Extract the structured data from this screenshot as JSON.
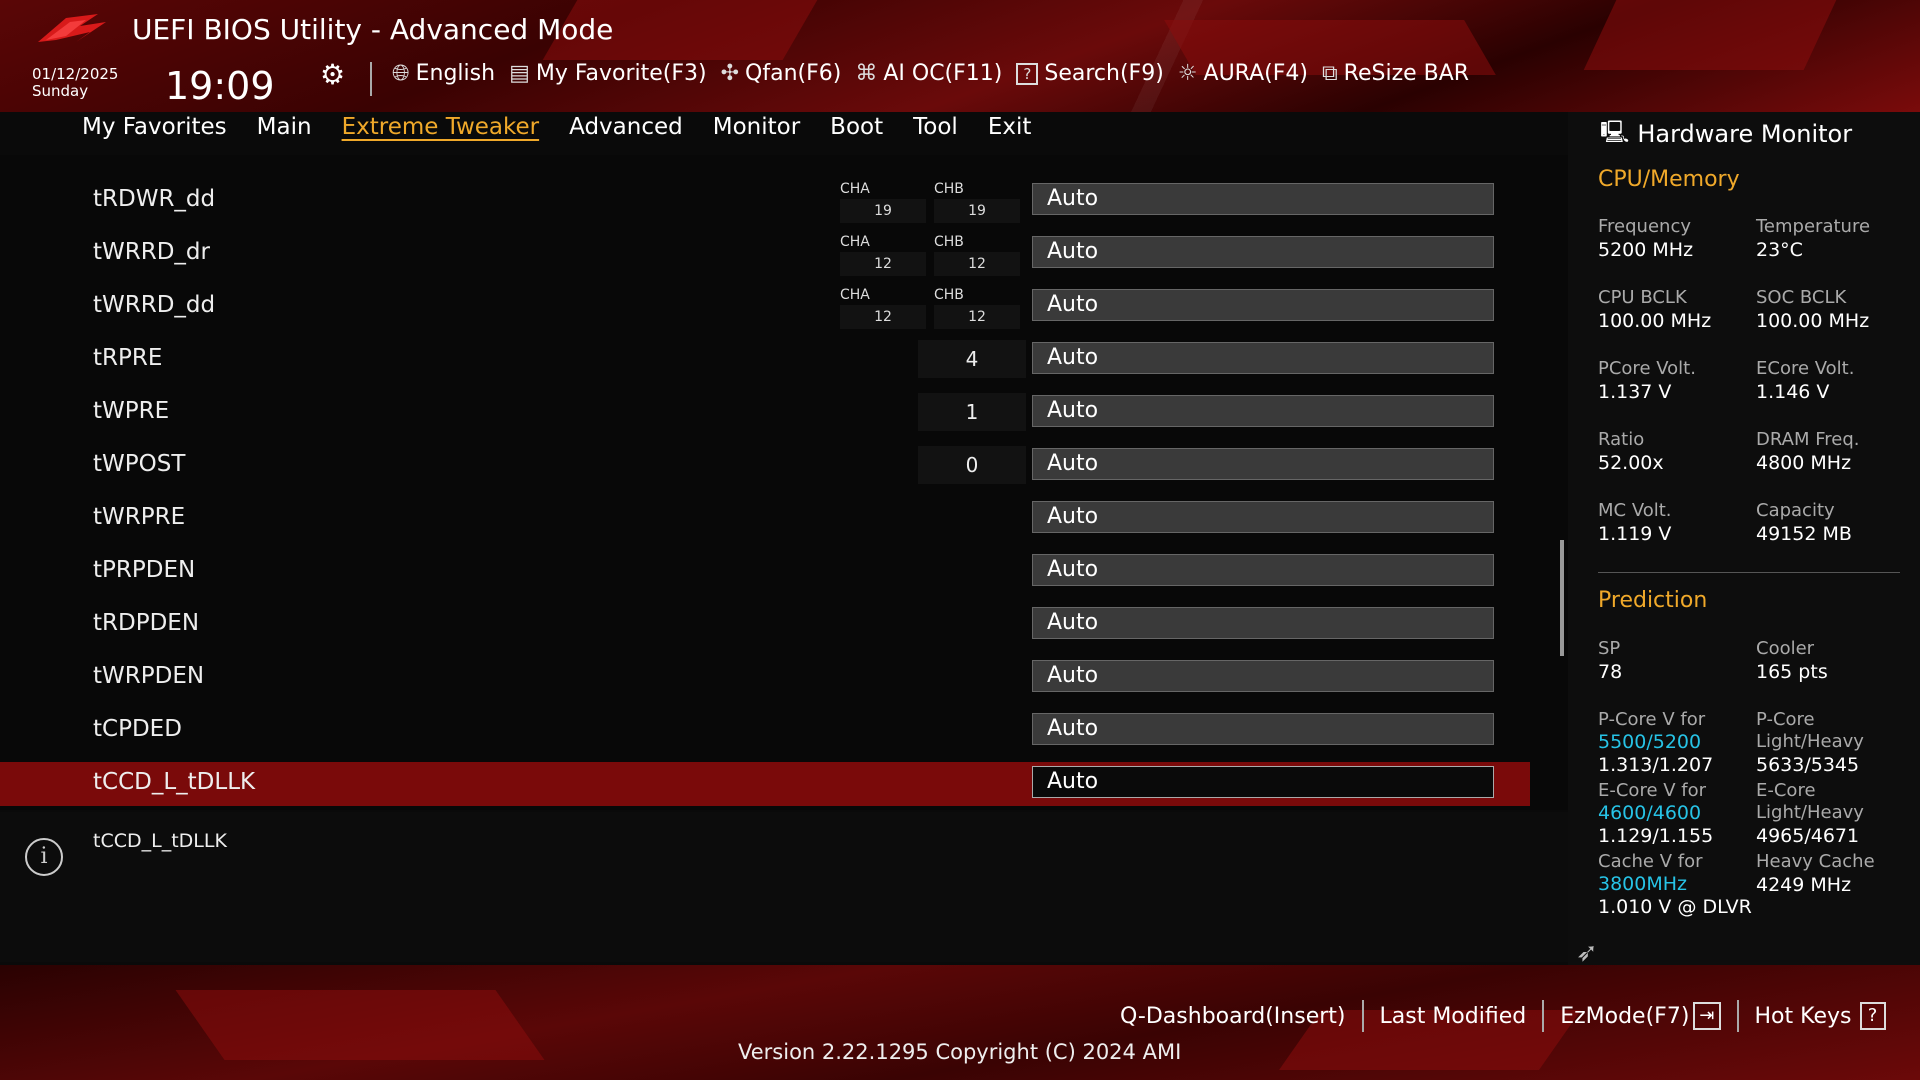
{
  "header": {
    "title": "UEFI BIOS Utility - Advanced Mode",
    "date": "01/12/2025",
    "day": "Sunday",
    "time": "19:09",
    "toolbar": [
      {
        "icon": "globe-icon",
        "label": "English"
      },
      {
        "icon": "favorite-list-icon",
        "label": "My Favorite(F3)"
      },
      {
        "icon": "fan-icon",
        "label": "Qfan(F6)"
      },
      {
        "icon": "ai-chip-icon",
        "label": "AI OC(F11)"
      },
      {
        "icon": "help-box-icon",
        "label": "Search(F9)"
      },
      {
        "icon": "aura-light-icon",
        "label": "AURA(F4)"
      },
      {
        "icon": "resize-bar-icon",
        "label": "ReSize BAR"
      }
    ]
  },
  "menu": [
    {
      "label": "My Favorites",
      "active": false
    },
    {
      "label": "Main",
      "active": false
    },
    {
      "label": "Extreme Tweaker",
      "active": true
    },
    {
      "label": "Advanced",
      "active": false
    },
    {
      "label": "Monitor",
      "active": false
    },
    {
      "label": "Boot",
      "active": false
    },
    {
      "label": "Tool",
      "active": false
    },
    {
      "label": "Exit",
      "active": false
    }
  ],
  "settings": {
    "rows": [
      {
        "label": "tRDWR_dd",
        "value": "Auto",
        "cha_label": "CHA",
        "cha": "19",
        "chb_label": "CHB",
        "chb": "19"
      },
      {
        "label": "tWRRD_dr",
        "value": "Auto",
        "cha_label": "CHA",
        "cha": "12",
        "chb_label": "CHB",
        "chb": "12"
      },
      {
        "label": "tWRRD_dd",
        "value": "Auto",
        "cha_label": "CHA",
        "cha": "12",
        "chb_label": "CHB",
        "chb": "12"
      },
      {
        "label": "tRPRE",
        "value": "Auto",
        "single": "4"
      },
      {
        "label": "tWPRE",
        "value": "Auto",
        "single": "1"
      },
      {
        "label": "tWPOST",
        "value": "Auto",
        "single": "0"
      },
      {
        "label": "tWRPRE",
        "value": "Auto"
      },
      {
        "label": "tPRPDEN",
        "value": "Auto"
      },
      {
        "label": "tRDPDEN",
        "value": "Auto"
      },
      {
        "label": "tWRPDEN",
        "value": "Auto"
      },
      {
        "label": "tCPDED",
        "value": "Auto"
      },
      {
        "label": "tCCD_L_tDLLK",
        "value": "Auto",
        "selected": true
      }
    ]
  },
  "info": {
    "text": "tCCD_L_tDLLK"
  },
  "hw": {
    "title": "Hardware Monitor",
    "cpu_section": "CPU/Memory",
    "freq_l": "Frequency",
    "freq_v": "5200 MHz",
    "temp_l": "Temperature",
    "temp_v": "23°C",
    "cpubclk_l": "CPU BCLK",
    "cpubclk_v": "100.00 MHz",
    "socbclk_l": "SOC BCLK",
    "socbclk_v": "100.00 MHz",
    "pcore_l": "PCore Volt.",
    "pcore_v": "1.137 V",
    "ecore_l": "ECore Volt.",
    "ecore_v": "1.146 V",
    "ratio_l": "Ratio",
    "ratio_v": "52.00x",
    "dram_l": "DRAM Freq.",
    "dram_v": "4800 MHz",
    "mc_l": "MC Volt.",
    "mc_v": "1.119 V",
    "cap_l": "Capacity",
    "cap_v": "49152 MB",
    "pred_section": "Prediction",
    "sp_l": "SP",
    "sp_v": "78",
    "cooler_l": "Cooler",
    "cooler_v": "165 pts",
    "pcv_l": "P-Core V for",
    "pcv_c": "5500/5200",
    "pcv_v": "1.313/1.207",
    "pclh_l1": "P-Core",
    "pclh_l2": "Light/Heavy",
    "pclh_v": "5633/5345",
    "ecv_l": "E-Core V for",
    "ecv_c": "4600/4600",
    "ecv_v": "1.129/1.155",
    "eclh_l1": "E-Core",
    "eclh_l2": "Light/Heavy",
    "eclh_v": "4965/4671",
    "cv_l": "Cache V for",
    "cv_c": "3800MHz",
    "cv_v": "1.010 V @ DLVR",
    "hc_l": "Heavy Cache",
    "hc_v": "4249 MHz"
  },
  "footer": {
    "qdash": "Q-Dashboard(Insert)",
    "last": "Last Modified",
    "ez": "EzMode(F7)",
    "hotkeys": "Hot Keys",
    "version": "Version 2.22.1295 Copyright (C) 2024 AMI"
  }
}
